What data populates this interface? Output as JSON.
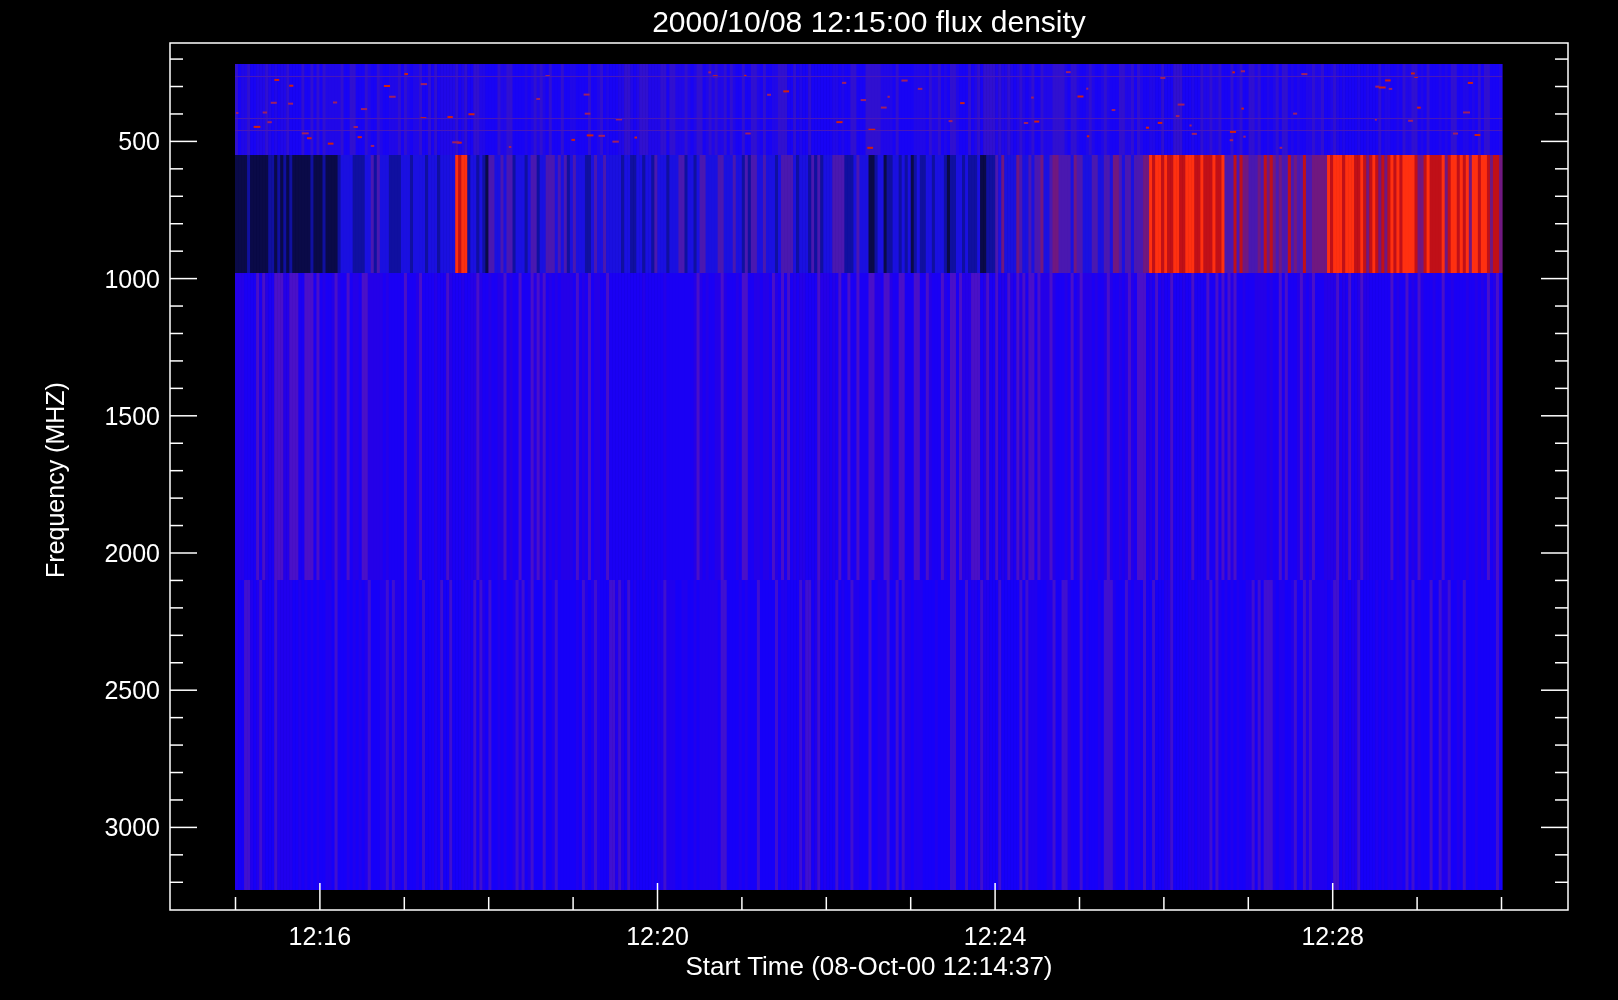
{
  "plot": {
    "title": "2000/10/08 12:15:00 flux density",
    "ylabel": "Frequency (MHZ)",
    "xlabel": "Start Time (08-Oct-00 12:14:37)",
    "yticks": [
      "500",
      "1000",
      "1500",
      "2000",
      "2500",
      "3000"
    ],
    "xticks": [
      "12:16",
      "12:20",
      "12:24",
      "12:28"
    ]
  }
}
